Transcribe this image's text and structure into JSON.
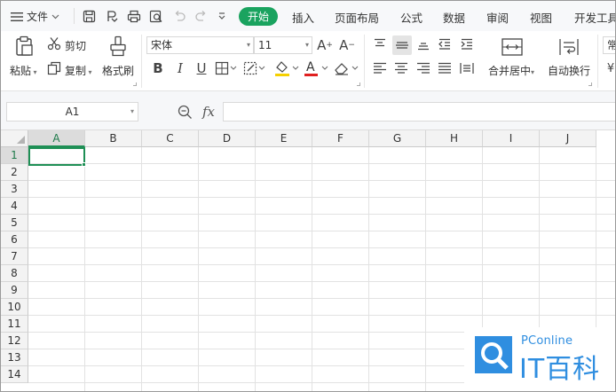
{
  "titlebar": {
    "menu_label": "文件",
    "tabs": [
      "开始",
      "插入",
      "页面布局",
      "公式",
      "数据",
      "审阅",
      "视图",
      "开发工具"
    ],
    "active_tab": "开始"
  },
  "ribbon": {
    "paste": "粘贴",
    "cut": "剪切",
    "copy": "复制",
    "format_painter": "格式刷",
    "font_name": "宋体",
    "font_size": "11",
    "bold": "B",
    "italic": "I",
    "underline": "U",
    "font_color_letter": "A",
    "merge_center": "合并居中",
    "wrap_text": "自动换行",
    "number_format_partial": "常"
  },
  "formula_bar": {
    "name_box": "A1",
    "fx_label": "fx",
    "formula_value": ""
  },
  "sheet": {
    "columns": [
      "A",
      "B",
      "C",
      "D",
      "E",
      "F",
      "G",
      "H",
      "I",
      "J"
    ],
    "rows": [
      "1",
      "2",
      "3",
      "4",
      "5",
      "6",
      "7",
      "8",
      "9",
      "10",
      "11",
      "12",
      "13",
      "14"
    ],
    "selected_cell": "A1"
  },
  "watermark": {
    "site": "PConline",
    "brand": "IT百科"
  },
  "colors": {
    "accent_green": "#1aa35f",
    "selection_green": "#1e8f55",
    "watermark_blue": "#2f8ee0",
    "font_color_bar": "#e02020",
    "fill_color_bar": "#f5d000"
  }
}
